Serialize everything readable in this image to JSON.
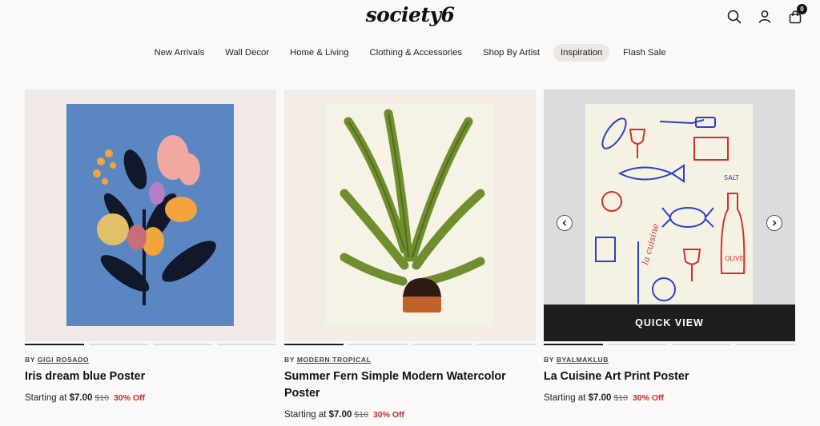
{
  "header": {
    "logo": "society6",
    "icons": [
      "search-icon",
      "user-icon",
      "cart-icon"
    ],
    "cart_count": "0"
  },
  "nav": {
    "items": [
      {
        "label": "New Arrivals"
      },
      {
        "label": "Wall Decor"
      },
      {
        "label": "Home & Living"
      },
      {
        "label": "Clothing & Accessories"
      },
      {
        "label": "Shop By Artist"
      },
      {
        "label": "Inspiration",
        "active": true
      },
      {
        "label": "Flash Sale"
      }
    ]
  },
  "products": [
    {
      "by": "BY",
      "artist": "GIGI ROSADO",
      "title": "Iris dream blue Poster",
      "price_prefix": "Starting at",
      "price": "$7.00",
      "old_price": "$10",
      "discount": "30% Off",
      "active_image": 1,
      "image_count": 4
    },
    {
      "by": "BY",
      "artist": "MODERN TROPICAL",
      "title": "Summer Fern Simple Modern Watercolor Poster",
      "price_prefix": "Starting at",
      "price": "$7.00",
      "old_price": "$10",
      "discount": "30% Off",
      "active_image": 1,
      "image_count": 4
    },
    {
      "by": "BY",
      "artist": "BYALMAKLUB",
      "title": "La Cuisine Art Print Poster",
      "price_prefix": "Starting at",
      "price": "$7.00",
      "old_price": "$10",
      "discount": "30% Off",
      "active_image": 1,
      "image_count": 4,
      "quick_view": "QUICK VIEW",
      "print_words": [
        "SALT",
        "OLIVE",
        "la cuisine"
      ]
    }
  ],
  "colors": {
    "sale": "#c42f2f",
    "quick_view_bg": "#1e1e1e",
    "nav_active_bg": "#ebe8e3",
    "poster1_bg": "#5a87c2",
    "poster2_leaf": "#6f8f2e",
    "poster3_ink_blue": "#2d3fc7",
    "poster3_ink_red": "#d2302b"
  }
}
